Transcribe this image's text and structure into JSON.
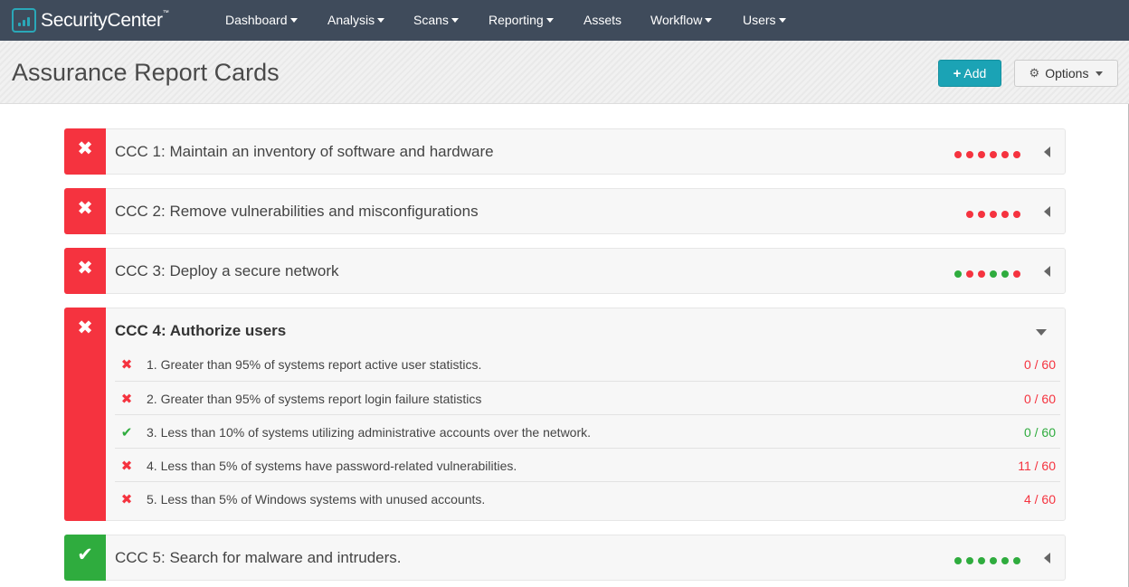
{
  "nav": {
    "brand": "SecurityCenter",
    "trademark": "™",
    "items": [
      {
        "label": "Dashboard",
        "dropdown": true
      },
      {
        "label": "Analysis",
        "dropdown": true
      },
      {
        "label": "Scans",
        "dropdown": true
      },
      {
        "label": "Reporting",
        "dropdown": true
      },
      {
        "label": "Assets",
        "dropdown": false
      },
      {
        "label": "Workflow",
        "dropdown": true
      },
      {
        "label": "Users",
        "dropdown": true
      }
    ]
  },
  "header": {
    "title": "Assurance Report Cards",
    "add_label": "Add",
    "add_icon": "+",
    "options_label": "Options",
    "options_icon": "⚙"
  },
  "colors": {
    "nav_bg": "#3f4b5b",
    "accent": "#1ba3b5",
    "fail": "#f5333f",
    "pass": "#2fac3e"
  },
  "cards": [
    {
      "title": "CCC 1: Maintain an inventory of software and hardware",
      "status": "fail",
      "status_icon": "✖",
      "dots": [
        "fail",
        "fail",
        "fail",
        "fail",
        "fail",
        "fail"
      ],
      "expanded": false
    },
    {
      "title": "CCC 2: Remove vulnerabilities and misconfigurations",
      "status": "fail",
      "status_icon": "✖",
      "dots": [
        "fail",
        "fail",
        "fail",
        "fail",
        "fail"
      ],
      "expanded": false
    },
    {
      "title": "CCC 3: Deploy a secure network",
      "status": "fail",
      "status_icon": "✖",
      "dots": [
        "pass",
        "fail",
        "fail",
        "pass",
        "pass",
        "fail"
      ],
      "expanded": false
    },
    {
      "title": "CCC 4: Authorize users",
      "status": "fail",
      "status_icon": "✖",
      "expanded": true,
      "rules": [
        {
          "text": "1. Greater than 95% of systems report active user statistics.",
          "status": "fail",
          "icon": "✖",
          "count": "0 / 60"
        },
        {
          "text": "2. Greater than 95% of systems report login failure statistics",
          "status": "fail",
          "icon": "✖",
          "count": "0 / 60"
        },
        {
          "text": "3. Less than 10% of systems utilizing administrative accounts over the network.",
          "status": "pass",
          "icon": "✔",
          "count": "0 / 60"
        },
        {
          "text": "4. Less than 5% of systems have password-related vulnerabilities.",
          "status": "fail",
          "icon": "✖",
          "count": "11 / 60"
        },
        {
          "text": "5. Less than 5% of Windows systems with unused accounts.",
          "status": "fail",
          "icon": "✖",
          "count": "4 / 60"
        }
      ]
    },
    {
      "title": "CCC 5: Search for malware and intruders.",
      "status": "pass",
      "status_icon": "✔",
      "dots": [
        "pass",
        "pass",
        "pass",
        "pass",
        "pass",
        "pass"
      ],
      "expanded": false
    }
  ]
}
